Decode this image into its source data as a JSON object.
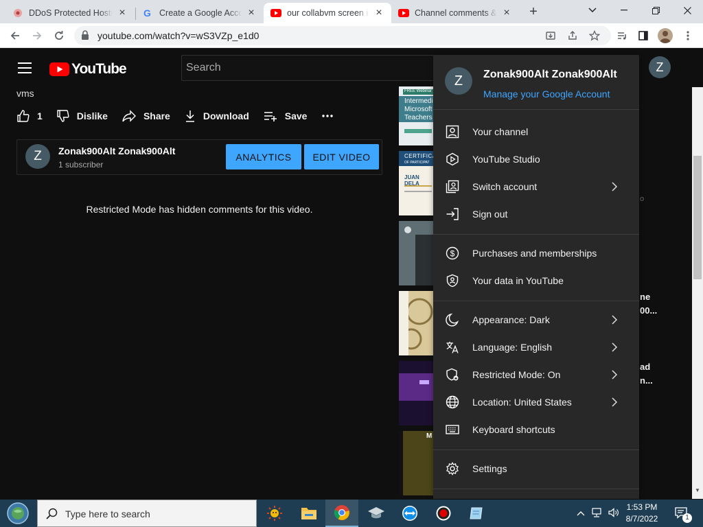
{
  "browser": {
    "tabs": [
      {
        "title": "DDoS Protected Hosting",
        "active": false
      },
      {
        "title": "Create a Google Account",
        "active": false
      },
      {
        "title": "our collabvm screen is",
        "active": true
      },
      {
        "title": "Channel comments & m",
        "active": false
      }
    ],
    "url": "youtube.com/watch?v=wS3VZp_e1d0"
  },
  "youtube": {
    "logo_text": "YouTube",
    "search_placeholder": "Search",
    "avatar_letter": "Z",
    "video_title": "vms",
    "actions": {
      "like_count": "1",
      "dislike": "Dislike",
      "share": "Share",
      "download": "Download",
      "save": "Save"
    },
    "channel": {
      "avatar_letter": "Z",
      "name": "Zonak900Alt Zonak900Alt",
      "subscribers": "1 subscriber",
      "analytics_label": "ANALYTICS",
      "edit_label": "EDIT VIDEO"
    },
    "restricted_notice": "Restricted Mode has hidden comments for this video.",
    "side_fragments": {
      "t1": "FREE Webinar",
      "t2": "Intermedia",
      "t3": "Microsoft",
      "t4": "Teachers",
      "t5": "CERTIFICA",
      "t6": "OF PARTICIPAT",
      "t7": "JUAN DELA",
      "t8": "M",
      "r1": "ne",
      "r2": "00...",
      "r3": "ad",
      "r4": "n...",
      "r5": "o"
    }
  },
  "account_menu": {
    "avatar_letter": "Z",
    "name": "Zonak900Alt Zonak900Alt",
    "manage_link": "Manage your Google Account",
    "items": [
      {
        "label": "Your channel",
        "icon": "person-box-icon",
        "chevron": false
      },
      {
        "label": "YouTube Studio",
        "icon": "studio-icon",
        "chevron": false
      },
      {
        "label": "Switch account",
        "icon": "switch-account-icon",
        "chevron": true
      },
      {
        "label": "Sign out",
        "icon": "sign-out-icon",
        "chevron": false
      },
      {
        "label": "Purchases and memberships",
        "icon": "dollar-icon",
        "chevron": false
      },
      {
        "label": "Your data in YouTube",
        "icon": "shield-person-icon",
        "chevron": false
      },
      {
        "label": "Appearance: Dark",
        "icon": "moon-icon",
        "chevron": true
      },
      {
        "label": "Language: English",
        "icon": "translate-icon",
        "chevron": true
      },
      {
        "label": "Restricted Mode: On",
        "icon": "restricted-icon",
        "chevron": true
      },
      {
        "label": "Location: United States",
        "icon": "globe-icon",
        "chevron": true
      },
      {
        "label": "Keyboard shortcuts",
        "icon": "keyboard-icon",
        "chevron": false
      },
      {
        "label": "Settings",
        "icon": "gear-icon",
        "chevron": false
      }
    ]
  },
  "taskbar": {
    "search_placeholder": "Type here to search",
    "time": "1:53 PM",
    "date": "8/7/2022",
    "notification_count": "1"
  },
  "colors": {
    "accent_blue": "#3ea6ff",
    "menu_bg": "#282828",
    "page_bg": "#0f0f0f",
    "youtube_red": "#ff0000"
  }
}
